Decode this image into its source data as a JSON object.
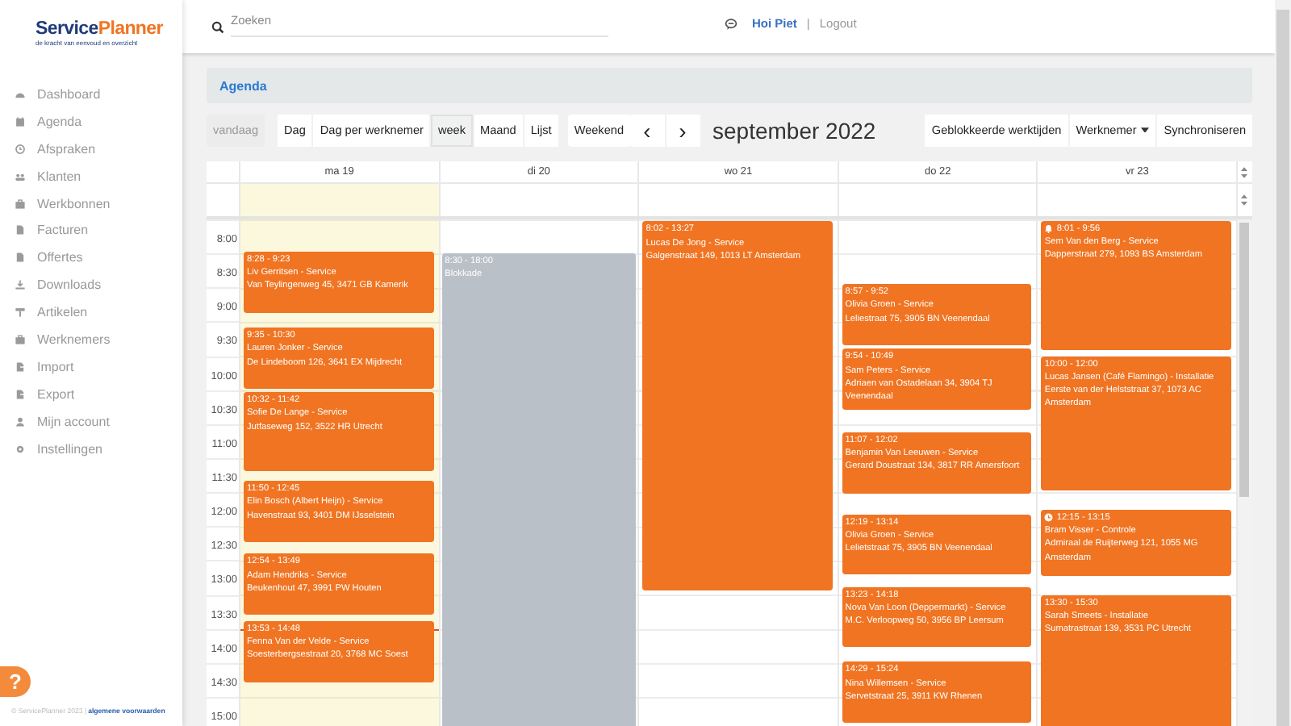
{
  "sidebar": {
    "logo": [
      "Service",
      "Planner"
    ],
    "tagline": "de kracht van eenvoud en overzicht",
    "items": [
      {
        "label": "Dashboard",
        "selected": false
      },
      {
        "label": "Agenda",
        "selected": false
      },
      {
        "label": "Afspraken",
        "selected": false
      },
      {
        "label": "Klanten",
        "selected": false
      },
      {
        "label": "Werkbonnen",
        "selected": false
      },
      {
        "label": "Facturen",
        "selected": false
      },
      {
        "label": "Offertes",
        "selected": false
      },
      {
        "label": "Downloads",
        "selected": false
      },
      {
        "label": "Artikelen",
        "selected": false
      },
      {
        "label": "Werknemers",
        "selected": false
      },
      {
        "label": "Import",
        "selected": false
      },
      {
        "label": "Export",
        "selected": false
      },
      {
        "label": "Mijn account",
        "selected": false
      },
      {
        "label": "Instellingen",
        "selected": false
      }
    ],
    "help": "?",
    "copyright": "© ServicePlanner 2023 |",
    "terms_link": "algemene voorwaarden"
  },
  "topbar": {
    "search": {
      "placeholder": "Zoeken"
    },
    "greeting": "Hoi Piet",
    "separator": "|",
    "logout": "Logout"
  },
  "page_title": "Agenda",
  "toolbar": {
    "today": {
      "label": "vandaag",
      "disabled": true
    },
    "views": [
      {
        "label": "Dag",
        "selected": false
      },
      {
        "label": "Dag per werknemer",
        "selected": false
      },
      {
        "label": "week",
        "selected": true
      },
      {
        "label": "Maand",
        "selected": false
      },
      {
        "label": "Lijst",
        "selected": false
      }
    ],
    "weekend": "Weekend",
    "prev": "‹",
    "next": "›",
    "title": "september 2022",
    "actions": [
      {
        "label": "Geblokkeerde werktijden",
        "dropdown": false
      },
      {
        "label": "Werknemer",
        "dropdown": true
      },
      {
        "label": "Synchroniseren",
        "dropdown": false
      }
    ]
  },
  "calendar": {
    "times": [
      "8:00",
      "8:30",
      "9:00",
      "9:30",
      "10:00",
      "10:30",
      "11:00",
      "11:30",
      "12:00",
      "12:30",
      "13:00",
      "13:30",
      "14:00",
      "14:30",
      "15:00"
    ],
    "days": [
      {
        "label": "ma 19",
        "today": true,
        "events": [
          {
            "kind": "appointment",
            "time": "8:28 - 9:23",
            "title": "Liv Gerritsen - Service",
            "address": "Van Teylingenweg 45, 3471 GB Kamerik"
          },
          {
            "kind": "appointment",
            "time": "9:35 - 10:30",
            "title": "Lauren Jonker - Service",
            "address": "De Lindeboom 126, 3641 EX Mijdrecht"
          },
          {
            "kind": "appointment",
            "time": "10:32 - 11:42",
            "title": "Sofie De Lange - Service",
            "address": "Jutfaseweg 152, 3522 HR Utrecht"
          },
          {
            "kind": "appointment",
            "time": "11:50 - 12:45",
            "title": "Elin Bosch (Albert Heijn) - Service",
            "address": "Havenstraat 93, 3401 DM IJsselstein"
          },
          {
            "kind": "appointment",
            "time": "12:54 - 13:49",
            "title": "Adam Hendriks - Service",
            "address": "Beukenhout 47, 3991 PW Houten"
          },
          {
            "kind": "appointment",
            "time": "13:53 - 14:48",
            "title": "Fenna Van der Velde - Service",
            "address": "Soesterbergsestraat 20, 3768 MC Soest"
          }
        ]
      },
      {
        "label": "di 20",
        "today": false,
        "events": [
          {
            "kind": "blocked",
            "time": "8:30 - 18:00",
            "title": "Blokkade"
          }
        ]
      },
      {
        "label": "wo 21",
        "today": false,
        "events": [
          {
            "kind": "appointment",
            "time": "8:02 - 13:27",
            "title": "Lucas De Jong - Service",
            "address": "Galgenstraat 149, 1013 LT Amsterdam"
          }
        ]
      },
      {
        "label": "do 22",
        "today": false,
        "events": [
          {
            "kind": "appointment",
            "time": "8:57 - 9:52",
            "title": "Olivia Groen - Service",
            "address": "Leliestraat 75, 3905 BN Veenendaal"
          },
          {
            "kind": "appointment",
            "time": "9:54 - 10:49",
            "title": "Sam Peters - Service",
            "address": "Adriaen van Ostadelaan 34, 3904 TJ Veenendaal"
          },
          {
            "kind": "appointment",
            "time": "11:07 - 12:02",
            "title": "Benjamin Van Leeuwen - Service",
            "address": "Gerard Doustraat 134, 3817 RR Amersfoort"
          },
          {
            "kind": "appointment",
            "time": "12:19 - 13:14",
            "title": "Olivia Groen - Service",
            "address": "Lelietstraat 75, 3905 BN Veenendaal"
          },
          {
            "kind": "appointment",
            "time": "13:23 - 14:18",
            "title": "Nova Van Loon (Deppermarkt) - Service",
            "address": "M.C. Verloopweg 50, 3956 BP Leersum"
          },
          {
            "kind": "appointment",
            "time": "14:29 - 15:24",
            "title": "Nina Willemsen - Service",
            "address": "Servetstraat 25, 3911 KW Rhenen"
          }
        ]
      },
      {
        "label": "vr 23",
        "today": false,
        "events": [
          {
            "kind": "appointment",
            "alert": true,
            "time": "8:01 - 9:56",
            "title": "Sem Van den Berg - Service",
            "address": "Dapperstraat 279, 1093 BS Amsterdam"
          },
          {
            "kind": "appointment",
            "time": "10:00 - 12:00",
            "title": "Lucas Jansen (Café Flamingo) - Installatie",
            "address": "Eerste van der Helststraat 37, 1073 AC Amsterdam"
          },
          {
            "kind": "appointment",
            "fixed_time": true,
            "time": "12:15 - 13:15",
            "title": "Bram Visser - Controle",
            "address": "Admiraal de Ruijterweg 121, 1055 MG Amsterdam"
          },
          {
            "kind": "appointment",
            "time": "13:30 - 15:30",
            "title": "Sarah Smeets - Installatie",
            "address": "Sumatrastraat 139, 3531 PC Utrecht"
          }
        ]
      }
    ]
  }
}
